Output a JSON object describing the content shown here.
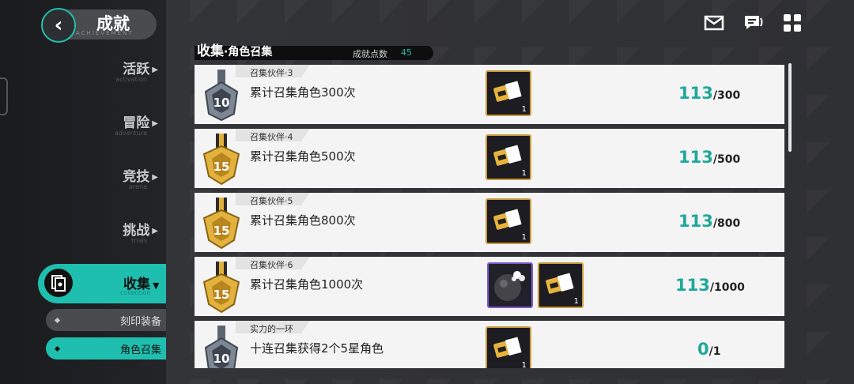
{
  "header": {
    "back_title": "成就",
    "back_subtitle": "ACHIEVEMENT"
  },
  "nav": {
    "items": [
      {
        "label": "活跃",
        "sub": "activation"
      },
      {
        "label": "冒险",
        "sub": "adventure"
      },
      {
        "label": "竞技",
        "sub": "arena"
      },
      {
        "label": "挑战",
        "sub": "trials"
      }
    ],
    "active": {
      "label": "收集",
      "sub": "collection"
    },
    "subitems": [
      {
        "label": "刻印装备"
      },
      {
        "label": "角色召集"
      }
    ]
  },
  "section": {
    "title": "收集",
    "subtitle": "·角色召集",
    "points_label": "成就点数",
    "points_value": "45"
  },
  "achievements": [
    {
      "tag": "召集伙伴·3",
      "desc": "累计召集角色300次",
      "medal": "10",
      "current": "113",
      "total": "/300",
      "rewards": [
        {
          "kind": "ticket",
          "qty": "1"
        }
      ]
    },
    {
      "tag": "召集伙伴·4",
      "desc": "累计召集角色500次",
      "medal": "15",
      "current": "113",
      "total": "/500",
      "rewards": [
        {
          "kind": "ticket",
          "qty": "1"
        }
      ]
    },
    {
      "tag": "召集伙伴·5",
      "desc": "累计召集角色800次",
      "medal": "15",
      "current": "113",
      "total": "/800",
      "rewards": [
        {
          "kind": "ticket",
          "qty": "1"
        }
      ]
    },
    {
      "tag": "召集伙伴·6",
      "desc": "累计召集角色1000次",
      "medal": "15",
      "current": "113",
      "total": "/1000",
      "rewards": [
        {
          "kind": "orb",
          "qty": ""
        },
        {
          "kind": "ticket",
          "qty": "1"
        }
      ]
    },
    {
      "tag": "实力的一环",
      "desc": "十连召集获得2个5星角色",
      "medal": "10",
      "current": "0",
      "total": "/1",
      "rewards": [
        {
          "kind": "ticket",
          "qty": "1"
        }
      ]
    }
  ],
  "colors": {
    "accent": "#1fbfb0",
    "gold": "#c99a3a"
  },
  "icons": [
    "back-icon",
    "mail-icon",
    "chat-icon",
    "menu-grid-icon",
    "collection-icon"
  ]
}
